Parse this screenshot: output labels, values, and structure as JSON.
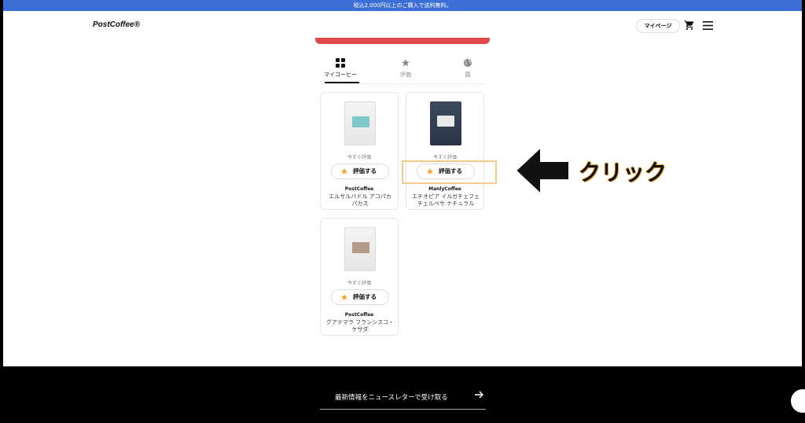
{
  "banner": {
    "text": "税込2,000円以上のご購入で送料無料。"
  },
  "header": {
    "logo": "PostCoffee®",
    "mypage_label": "マイページ"
  },
  "tabs": [
    {
      "label": "マイコーヒー",
      "icon": "grid-icon",
      "active": true
    },
    {
      "label": "評価",
      "icon": "star-icon",
      "active": false
    },
    {
      "label": "国",
      "icon": "globe-icon",
      "active": false
    }
  ],
  "products": [
    {
      "rate_now": "今すぐ評価",
      "rate_button": "評価する",
      "brand": "PostCoffee",
      "name": "エルサルバドル アコパカ パカス",
      "bag_color": "white",
      "label_color": "#7fc7c9"
    },
    {
      "rate_now": "今すぐ評価",
      "rate_button": "評価する",
      "brand": "ManlyCoffee",
      "name": "エチオピア イルガチェフェ チェルベサ ナチュラル",
      "bag_color": "navy",
      "label_color": "#e8e8e8"
    },
    {
      "rate_now": "今すぐ評価",
      "rate_button": "評価する",
      "brand": "PostCoffee",
      "name": "グアテマラ フランシスコ・ケサダ",
      "bag_color": "white",
      "label_color": "#b59a8a"
    }
  ],
  "annotation": {
    "text": "クリック"
  },
  "footer": {
    "newsletter": "最新情報をニュースレターで受け取る"
  },
  "colors": {
    "banner": "#3b6fd6",
    "accent_red": "#e04a4a",
    "star": "#f5a623",
    "highlight": "#f6c88a"
  }
}
